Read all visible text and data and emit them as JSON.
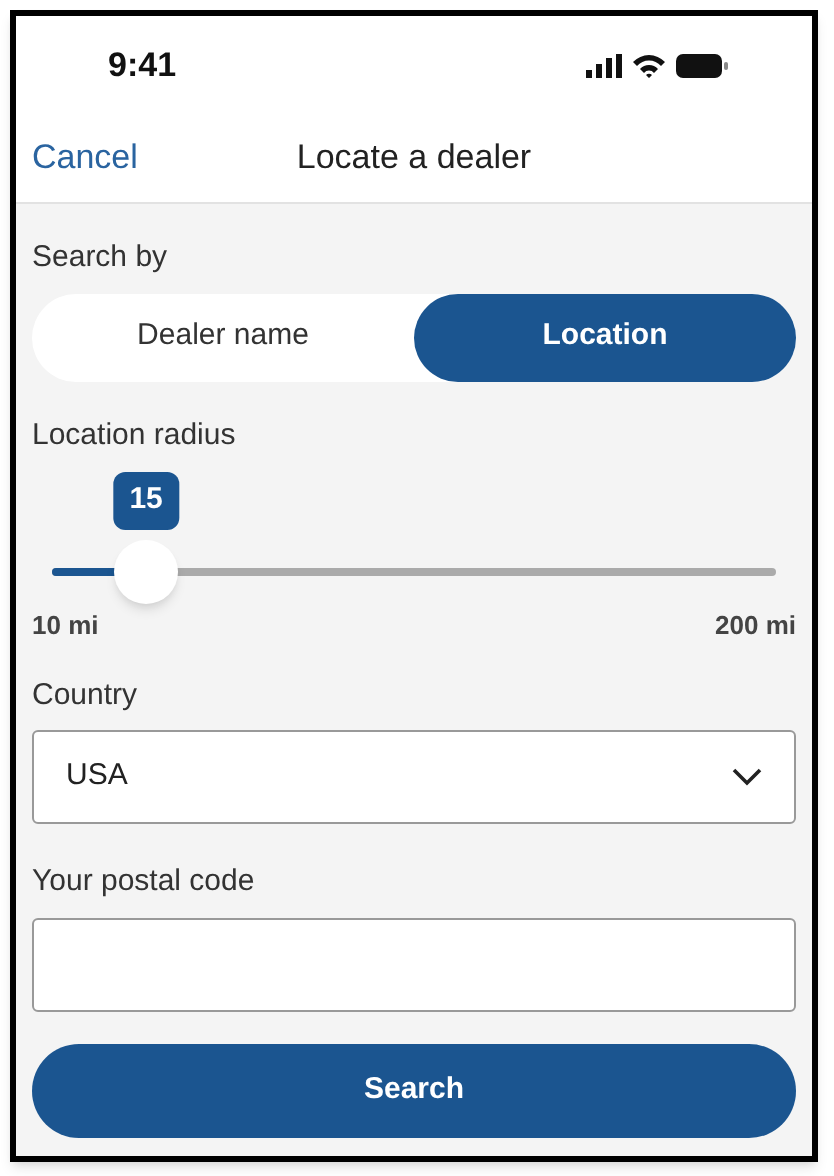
{
  "status_bar": {
    "time": "9:41"
  },
  "nav": {
    "cancel": "Cancel",
    "title": "Locate a dealer"
  },
  "search_by": {
    "label": "Search by",
    "options": [
      {
        "label": "Dealer name",
        "selected": false
      },
      {
        "label": "Location",
        "selected": true
      }
    ]
  },
  "radius": {
    "label": "Location radius",
    "value": "15",
    "level": 0.13,
    "min_label": "10 mi",
    "max_label": "200 mi"
  },
  "country": {
    "label": "Country",
    "value": "USA"
  },
  "postal": {
    "label": "Your postal code"
  },
  "search_button": "Search"
}
